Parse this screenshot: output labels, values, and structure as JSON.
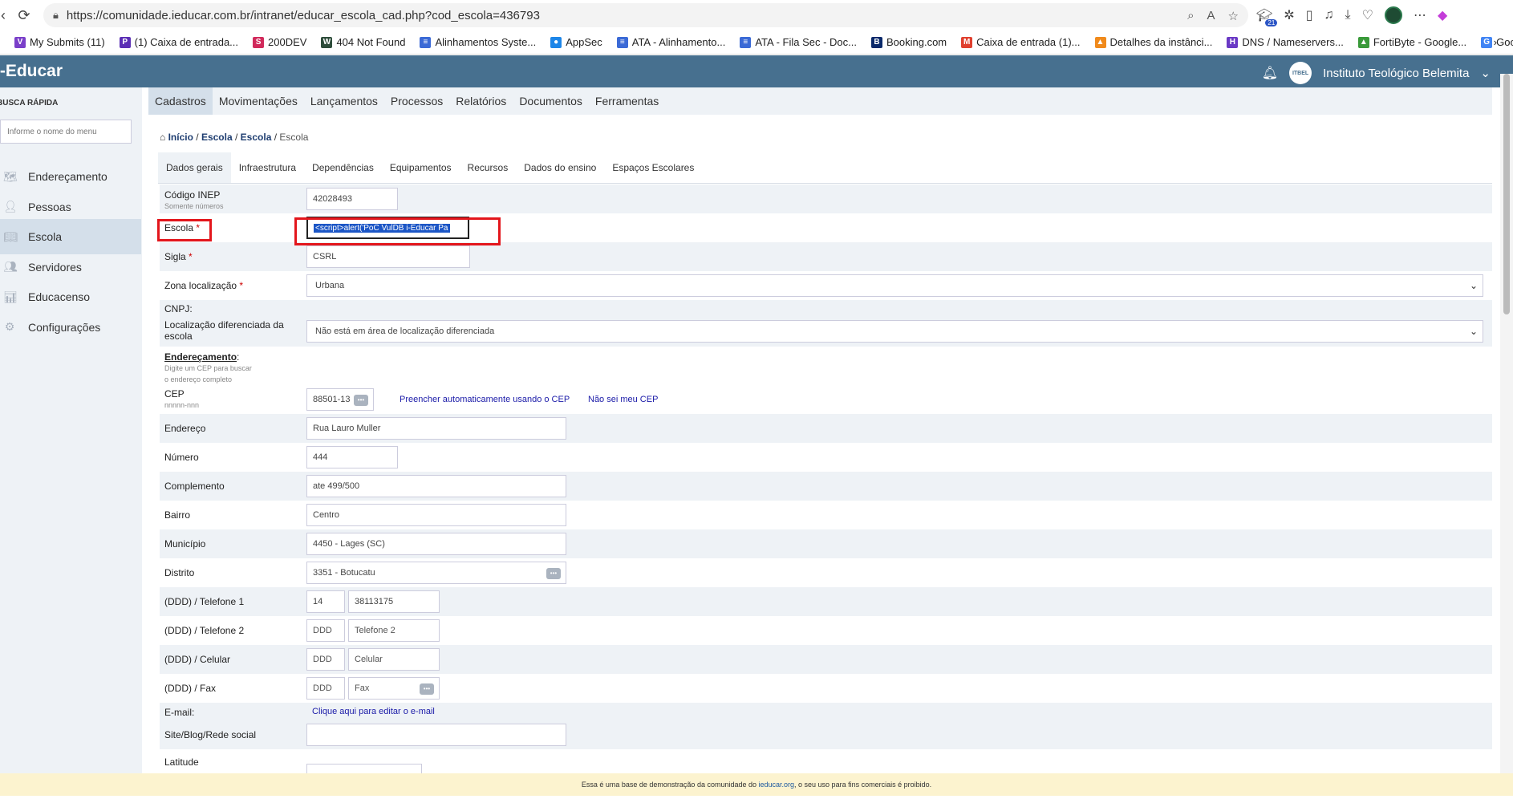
{
  "browser": {
    "url": "https://comunidade.ieducar.com.br/intranet/educar_escola_cad.php?cod_escola=436793",
    "ext_badge": "21",
    "bookmarks": [
      {
        "label": "My Submits (11)",
        "color": "#7a3fc9",
        "icon": "V"
      },
      {
        "label": "(1) Caixa de entrada...",
        "color": "#5b2fb5",
        "icon": "P"
      },
      {
        "label": "200DEV",
        "color": "#d12a5b",
        "icon": "S"
      },
      {
        "label": "404 Not Found",
        "color": "#2e4d3b",
        "icon": "W"
      },
      {
        "label": "Alinhamentos Syste...",
        "color": "#3b6ad6",
        "icon": "≡"
      },
      {
        "label": "AppSec",
        "color": "#1d86e8",
        "icon": "●"
      },
      {
        "label": "ATA - Alinhamento...",
        "color": "#3b6ad6",
        "icon": "≡"
      },
      {
        "label": "ATA - Fila Sec - Doc...",
        "color": "#3b6ad6",
        "icon": "≡"
      },
      {
        "label": "Booking.com",
        "color": "#0b2a6b",
        "icon": "B"
      },
      {
        "label": "Caixa de entrada (1)...",
        "color": "#e0402f",
        "icon": "M"
      },
      {
        "label": "Detalhes da instânci...",
        "color": "#f08a1c",
        "icon": "▲"
      },
      {
        "label": "DNS / Nameservers...",
        "color": "#6a39c5",
        "icon": "H"
      },
      {
        "label": "FortiByte - Google...",
        "color": "#3a9a3a",
        "icon": "▲"
      },
      {
        "label": "Google",
        "color": "#4285f4",
        "icon": "G"
      }
    ]
  },
  "app": {
    "brand": "i-Educar",
    "org_name": "Instituto Teológico Belemita",
    "org_logo_text": "ITBEL"
  },
  "sidebar": {
    "quick_title": "BUSCA RÁPIDA",
    "quick_placeholder": "Informe o nome do menu",
    "items": [
      {
        "label": "Endereçamento",
        "icon": "map-icon"
      },
      {
        "label": "Pessoas",
        "icon": "person-icon"
      },
      {
        "label": "Escola",
        "icon": "book-icon"
      },
      {
        "label": "Servidores",
        "icon": "group-icon"
      },
      {
        "label": "Educacenso",
        "icon": "bar-chart-icon"
      },
      {
        "label": "Configurações",
        "icon": "gear-icon"
      }
    ]
  },
  "menu": [
    "Cadastros",
    "Movimentações",
    "Lançamentos",
    "Processos",
    "Relatórios",
    "Documentos",
    "Ferramentas"
  ],
  "breadcrumb": {
    "home": "Início",
    "l1": "Escola",
    "l2": "Escola",
    "current": "Escola"
  },
  "tabs": [
    "Dados gerais",
    "Infraestrutura",
    "Dependências",
    "Equipamentos",
    "Recursos",
    "Dados do ensino",
    "Espaços Escolares"
  ],
  "form": {
    "inep_label": "Código INEP",
    "inep_sub": "Somente números",
    "inep_value": "42028493",
    "escola_label": "Escola",
    "escola_value": "<script>alert('PoC VulDB i-Educar Pa",
    "sigla_label": "Sigla",
    "sigla_value": "CSRL",
    "zona_label": "Zona localização",
    "zona_value": "Urbana",
    "cnpj_label": "CNPJ:",
    "loc_dif_label_1": "Localização diferenciada da",
    "loc_dif_label_2": "escola",
    "loc_dif_value": "Não está em área de localização diferenciada",
    "end_title": "Endereçamento",
    "end_sub_1": "Digite um CEP para buscar",
    "end_sub_2": "o endereço completo",
    "cep_label": "CEP",
    "cep_sub": "nnnnn-nnn",
    "cep_value": "88501-13",
    "cep_auto": "Preencher automaticamente usando o CEP",
    "cep_nao_sei": "Não sei meu CEP",
    "endereco_label": "Endereço",
    "endereco_value": "Rua Lauro Muller",
    "numero_label": "Número",
    "numero_value": "444",
    "complemento_label": "Complemento",
    "complemento_value": "ate 499/500",
    "bairro_label": "Bairro",
    "bairro_value": "Centro",
    "municipio_label": "Município",
    "municipio_value": "4450 - Lages (SC)",
    "distrito_label": "Distrito",
    "distrito_value": "3351 - Botucatu",
    "tel1_label": "(DDD) / Telefone 1",
    "tel1_ddd": "14",
    "tel1_num": "38113175",
    "tel2_label": "(DDD) / Telefone 2",
    "tel2_ddd_ph": "DDD",
    "tel2_num_ph": "Telefone 2",
    "cel_label": "(DDD) / Celular",
    "cel_ddd_ph": "DDD",
    "cel_num_ph": "Celular",
    "fax_label": "(DDD) / Fax",
    "fax_ddd_ph": "DDD",
    "fax_num_ph": "Fax",
    "email_label": "E-mail:",
    "email_link": "Clique aqui para editar o e-mail",
    "site_label": "Site/Blog/Rede social",
    "latitude_label": "Latitude"
  },
  "footer": {
    "pre": "Essa é uma base de demonstração da comunidade do ",
    "link": "ieducar.org",
    "post": ", o seu uso para fins comerciais é proibido."
  },
  "colors": {
    "header": "#47708f",
    "highlight": "#e3161c",
    "sidebar_bg": "#eef2f6"
  }
}
